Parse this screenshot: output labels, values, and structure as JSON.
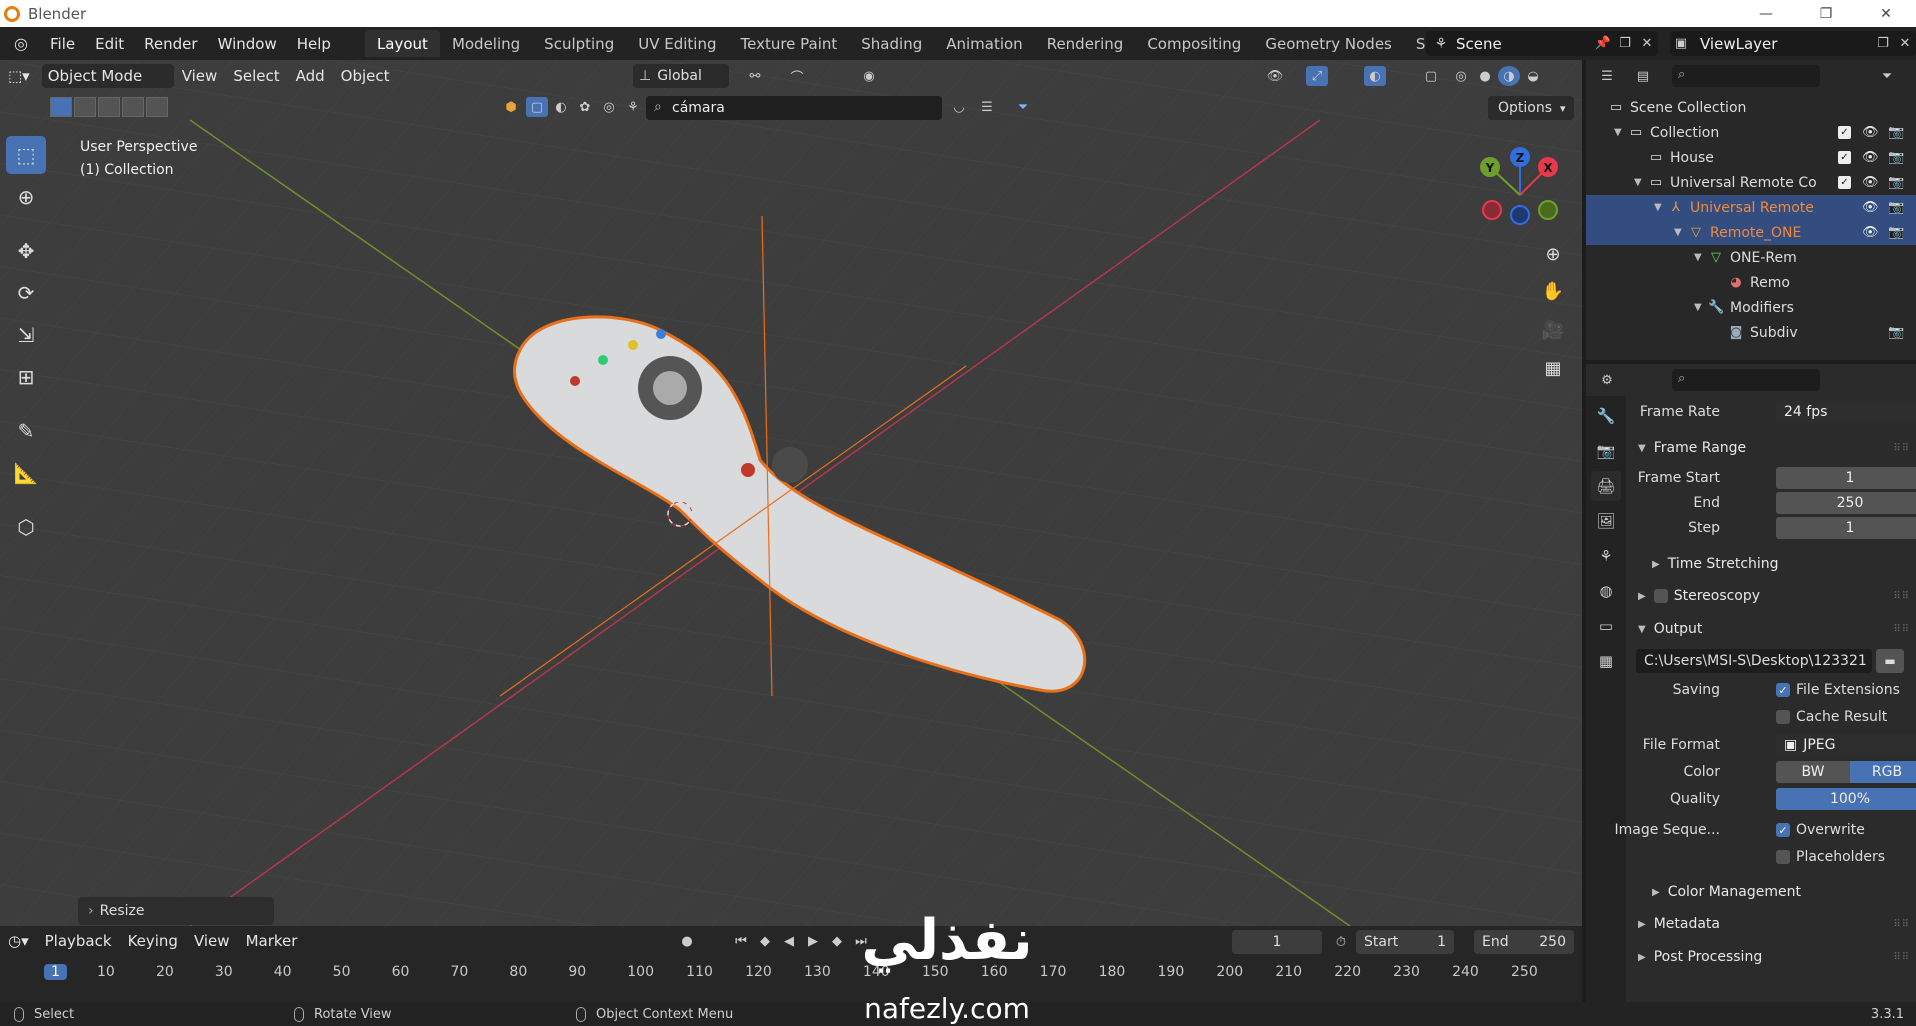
{
  "window": {
    "title": "Blender",
    "minimize": "—",
    "maximize": "❐",
    "close": "✕"
  },
  "menu": [
    "File",
    "Edit",
    "Render",
    "Window",
    "Help"
  ],
  "workspaces": [
    "Layout",
    "Modeling",
    "Sculpting",
    "UV Editing",
    "Texture Paint",
    "Shading",
    "Animation",
    "Rendering",
    "Compositing",
    "Geometry Nodes",
    "Scripting"
  ],
  "workspace_add": "+",
  "scene": "Scene",
  "view_layer": "ViewLayer",
  "viewport": {
    "mode": "Object Mode",
    "menus": [
      "View",
      "Select",
      "Add",
      "Object"
    ],
    "transform_orientation": "Global",
    "search_value": "cámara",
    "options_label": "Options",
    "info_line1": "User Perspective",
    "info_line2": "(1) Collection",
    "gizmo_labels": {
      "x": "X",
      "y": "Y",
      "z": "Z"
    },
    "last_op_panel": "Resize"
  },
  "timeline": {
    "menus": [
      "Playback",
      "Keying",
      "View",
      "Marker"
    ],
    "current_frame": "1",
    "start_label": "Start",
    "start_value": "1",
    "end_label": "End",
    "end_value": "250",
    "frames": [
      "1",
      "10",
      "20",
      "30",
      "40",
      "50",
      "60",
      "70",
      "80",
      "90",
      "100",
      "110",
      "120",
      "130",
      "140",
      "150",
      "160",
      "170",
      "180",
      "190",
      "200",
      "210",
      "220",
      "230",
      "240",
      "250"
    ]
  },
  "statusbar": {
    "left": "Select",
    "middle": "Rotate View",
    "right": "Object Context Menu",
    "version": "3.3.1"
  },
  "outliner": {
    "rows": [
      {
        "name": "Scene Collection"
      },
      {
        "name": "Collection"
      },
      {
        "name": "House"
      },
      {
        "name": "Universal Remote Co"
      },
      {
        "name": "Universal Remote"
      },
      {
        "name": "Remote_ONE"
      },
      {
        "name": "ONE-Rem"
      },
      {
        "name": "Remo"
      },
      {
        "name": "Modifiers"
      },
      {
        "name": "Subdiv"
      }
    ]
  },
  "properties": {
    "frame_rate_label": "Frame Rate",
    "frame_rate_value": "24 fps",
    "frame_range_title": "Frame Range",
    "frame_start_label": "Frame Start",
    "frame_start_value": "1",
    "end_label": "End",
    "end_value": "250",
    "step_label": "Step",
    "step_value": "1",
    "time_stretching": "Time Stretching",
    "stereoscopy": "Stereoscopy",
    "output_title": "Output",
    "output_path": "C:\\Users\\MSI-S\\Desktop\\123321",
    "saving_label": "Saving",
    "file_extensions": "File Extensions",
    "cache_result": "Cache Result",
    "file_format_label": "File Format",
    "file_format_value": "JPEG",
    "color_label": "Color",
    "color_bw": "BW",
    "color_rgb": "RGB",
    "quality_label": "Quality",
    "quality_value": "100%",
    "image_sequence_label": "Image Seque...",
    "overwrite": "Overwrite",
    "placeholders": "Placeholders",
    "color_management": "Color Management",
    "metadata": "Metadata",
    "post_processing": "Post Processing"
  },
  "watermark": {
    "arabic": "نفذلي",
    "latin": "nafezly.com"
  },
  "colors": {
    "accent": "#4772b3",
    "selection_outline": "#e8701a",
    "viewport_bg": "#3d3d3d"
  }
}
